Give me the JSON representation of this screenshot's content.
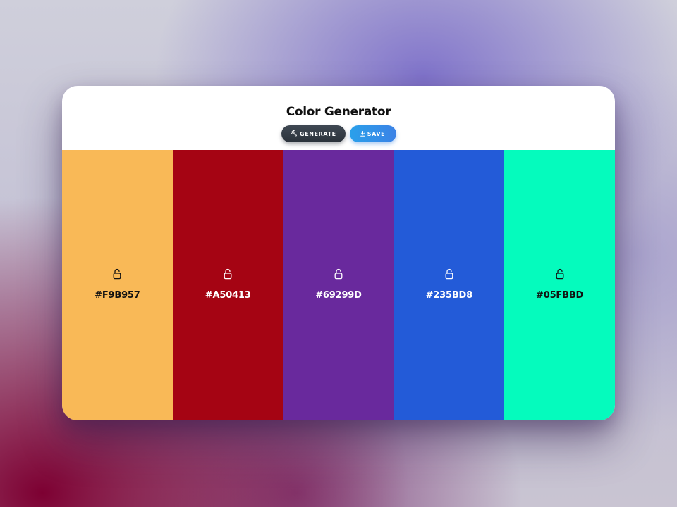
{
  "app": {
    "title": "Color Generator"
  },
  "toolbar": {
    "generate_label": "GENERATE",
    "generate_icon": "hammer-icon",
    "save_label": "SAVE",
    "save_icon": "download-icon"
  },
  "colors": {
    "generate_button": "#343b44",
    "save_button": "#3394e8"
  },
  "palette": [
    {
      "hex": "#F9B957",
      "text_color": "#111111",
      "icon": "unlocked-lock-icon"
    },
    {
      "hex": "#A50413",
      "text_color": "#ffffff",
      "icon": "unlocked-lock-icon"
    },
    {
      "hex": "#69299D",
      "text_color": "#ffffff",
      "icon": "unlocked-lock-icon"
    },
    {
      "hex": "#235BD8",
      "text_color": "#ffffff",
      "icon": "unlocked-lock-icon"
    },
    {
      "hex": "#05FBBD",
      "text_color": "#111111",
      "icon": "unlocked-lock-icon"
    }
  ]
}
